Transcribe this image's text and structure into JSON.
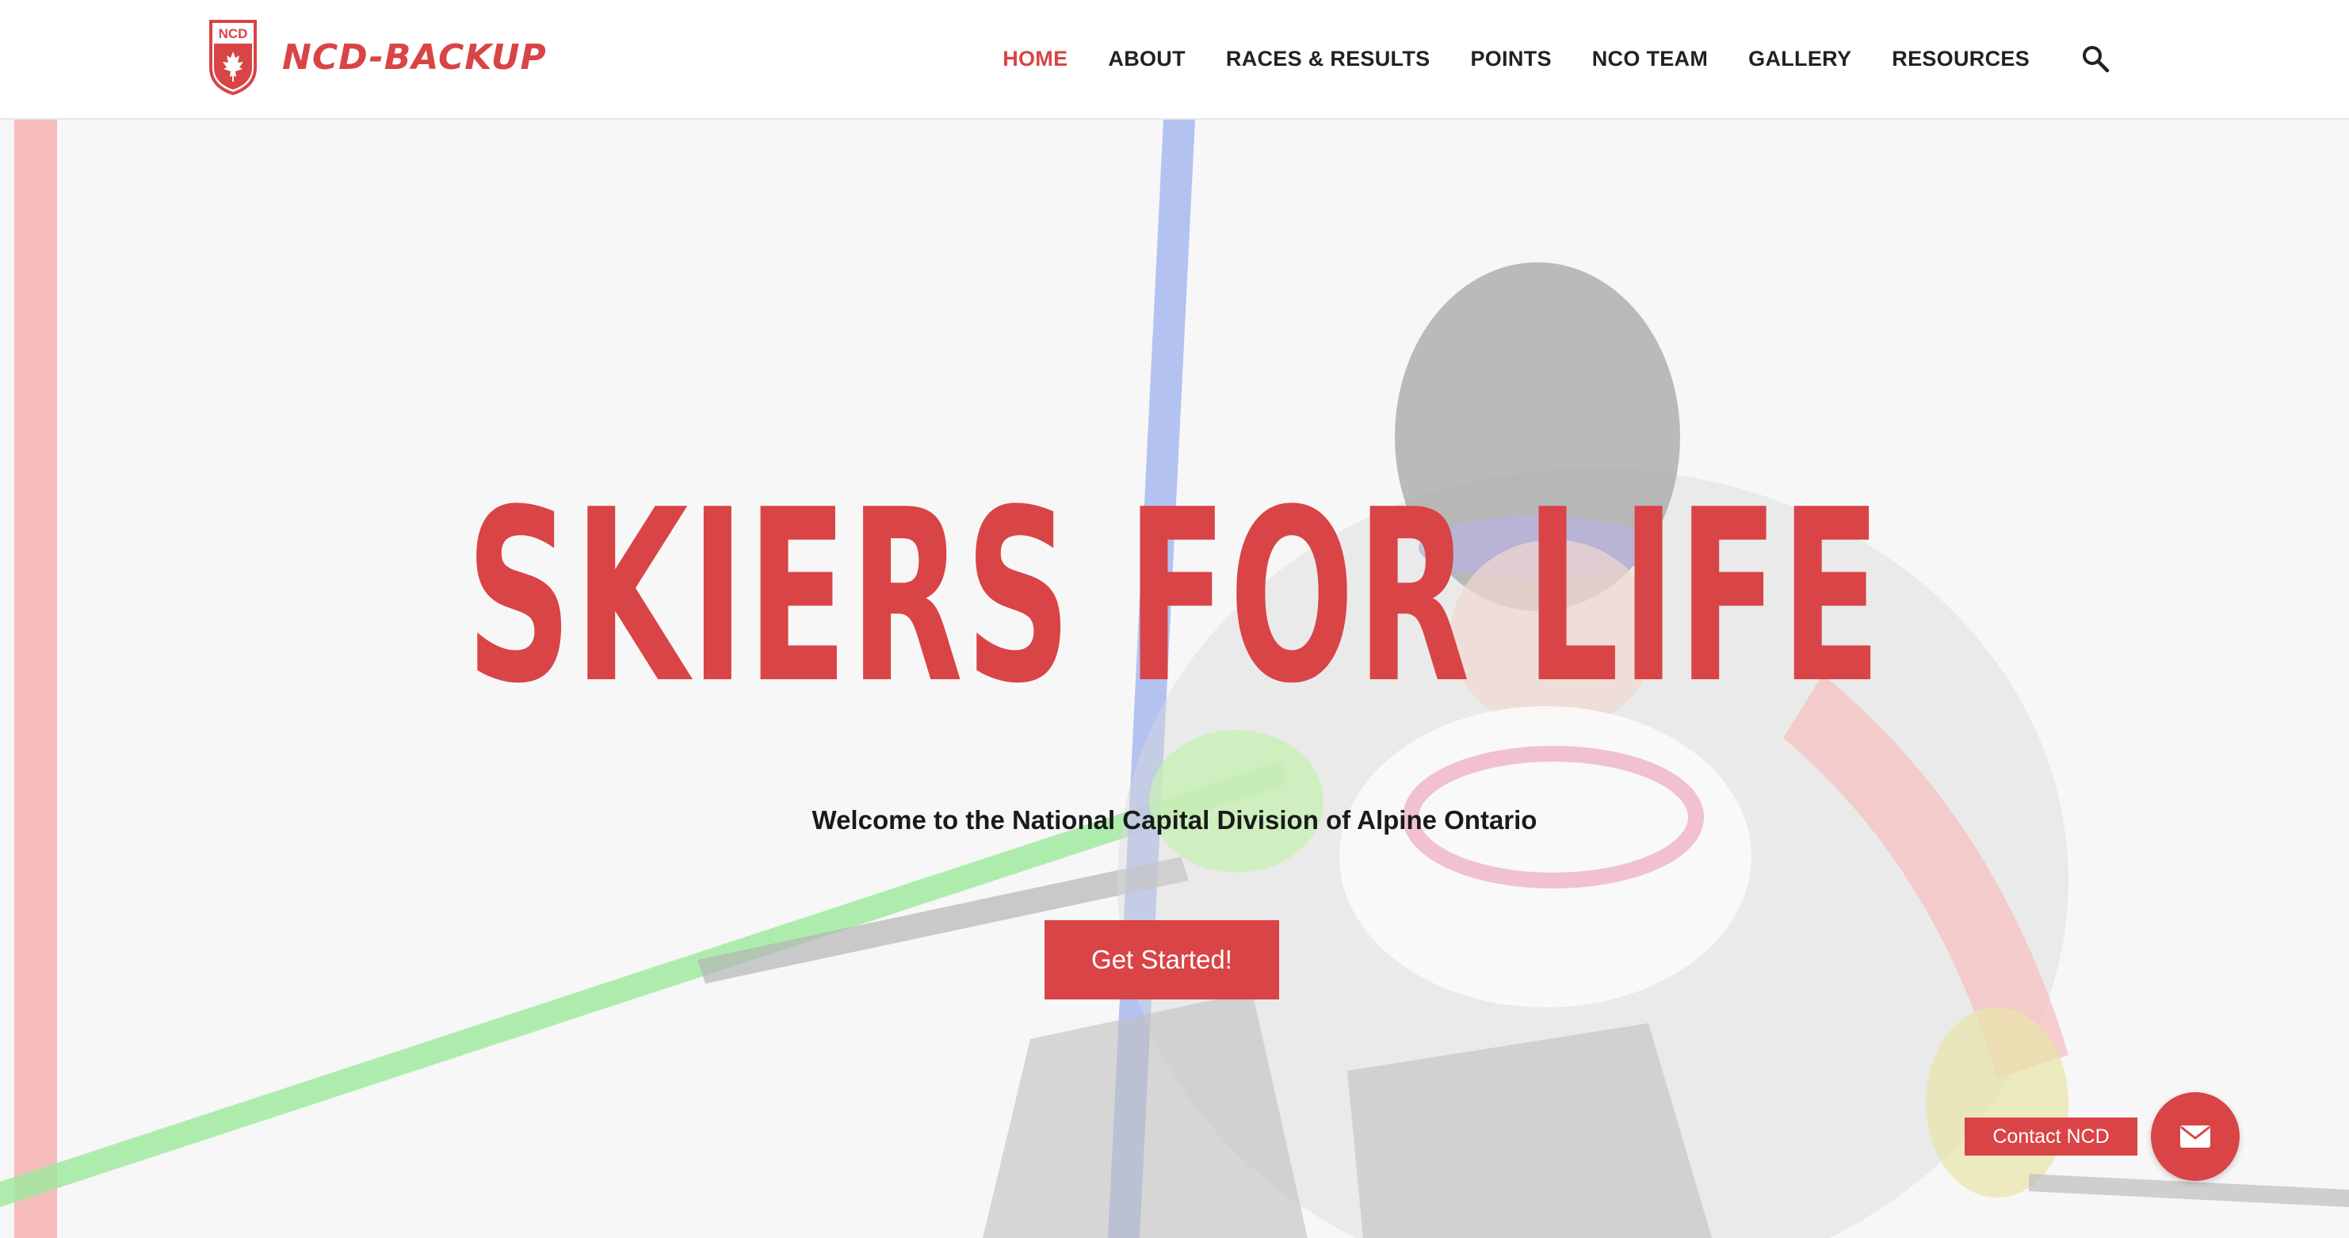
{
  "header": {
    "logo_badge": "NCD",
    "logo_text": "NCD-BACKUP",
    "nav": [
      {
        "label": "HOME",
        "active": true
      },
      {
        "label": "ABOUT",
        "active": false
      },
      {
        "label": "RACES & RESULTS",
        "active": false
      },
      {
        "label": "POINTS",
        "active": false
      },
      {
        "label": "NCO TEAM",
        "active": false
      },
      {
        "label": "GALLERY",
        "active": false
      },
      {
        "label": "RESOURCES",
        "active": false
      }
    ],
    "search_icon": "search-icon"
  },
  "hero": {
    "title": "SKIERS FOR LIFE",
    "subtitle": "Welcome to the National Capital Division of Alpine Ontario",
    "cta_label": "Get Started!"
  },
  "contact": {
    "label": "Contact NCD",
    "icon": "envelope-icon"
  },
  "colors": {
    "accent": "#d94446",
    "nav_text": "#222222",
    "header_bg": "#ffffff"
  }
}
